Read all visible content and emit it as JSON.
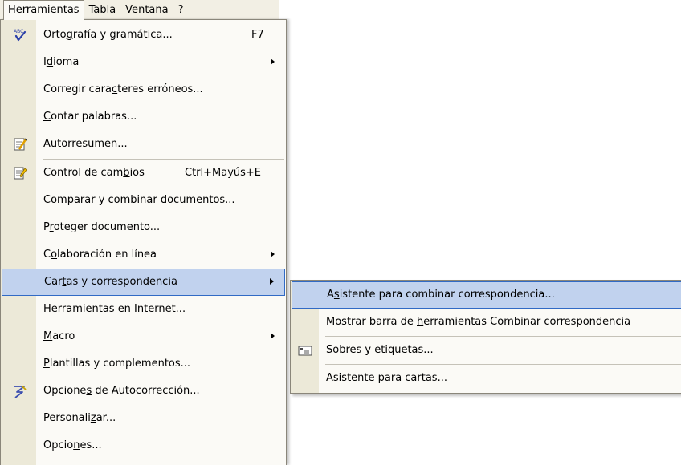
{
  "menubar": {
    "items": [
      {
        "pre": "",
        "mn": "H",
        "post": "erramientas"
      },
      {
        "pre": "Tab",
        "mn": "l",
        "post": "a"
      },
      {
        "pre": "Ve",
        "mn": "n",
        "post": "tana"
      },
      {
        "pre": "",
        "mn": "?",
        "post": ""
      }
    ]
  },
  "tools_menu": {
    "items": [
      {
        "pre": "Orto",
        "mn": "g",
        "post": "rafía y gramática...",
        "shortcut": "F7"
      },
      {
        "pre": "I",
        "mn": "d",
        "post": "ioma"
      },
      {
        "pre": "Corregir cara",
        "mn": "c",
        "post": "teres erróneos..."
      },
      {
        "pre": "",
        "mn": "C",
        "post": "ontar palabras..."
      },
      {
        "pre": "Autorres",
        "mn": "u",
        "post": "men..."
      },
      {
        "pre": "Control de cam",
        "mn": "b",
        "post": "ios",
        "shortcut": "Ctrl+Mayús+E"
      },
      {
        "pre": "Comparar y combi",
        "mn": "n",
        "post": "ar documentos..."
      },
      {
        "pre": "P",
        "mn": "r",
        "post": "oteger documento..."
      },
      {
        "pre": "C",
        "mn": "o",
        "post": "laboración en línea"
      },
      {
        "pre": "Car",
        "mn": "t",
        "post": "as y correspondencia"
      },
      {
        "pre": "",
        "mn": "H",
        "post": "erramientas en Internet..."
      },
      {
        "pre": "",
        "mn": "M",
        "post": "acro"
      },
      {
        "pre": "",
        "mn": "P",
        "post": "lantillas y complementos..."
      },
      {
        "pre": "Opcione",
        "mn": "s",
        "post": " de Autocorrección..."
      },
      {
        "pre": "Personali",
        "mn": "z",
        "post": "ar..."
      },
      {
        "pre": "Opcio",
        "mn": "n",
        "post": "es..."
      }
    ]
  },
  "submenu": {
    "items": [
      {
        "pre": "A",
        "mn": "s",
        "post": "istente para combinar correspondencia..."
      },
      {
        "pre": "Mostrar barra de ",
        "mn": "h",
        "post": "erramientas Combinar correspondencia"
      },
      {
        "pre": "Sobres y eti",
        "mn": "q",
        "post": "uetas..."
      },
      {
        "pre": "",
        "mn": "A",
        "post": "sistente para cartas..."
      }
    ]
  },
  "icons": {
    "spelling": "spelling-check-icon",
    "autosummarize": "autosummarize-icon",
    "track_changes": "track-changes-icon",
    "autocorrect": "autocorrect-lightning-icon",
    "envelope": "envelope-labels-icon"
  },
  "colors": {
    "menu_bg": "#fbfaf6",
    "gutter": "#ece9d8",
    "highlight": "#c1d2ee",
    "highlight_border": "#316ac5"
  }
}
